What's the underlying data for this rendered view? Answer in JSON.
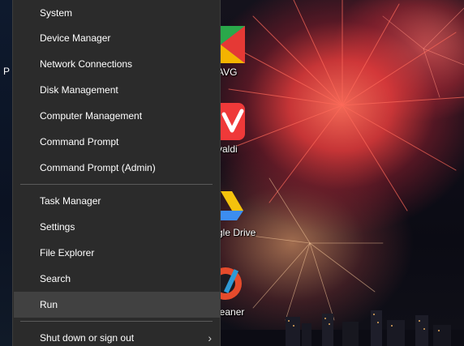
{
  "desktop": {
    "left_label": "P",
    "icons": [
      {
        "name": "avg-desktop-icon",
        "label": "AVG"
      },
      {
        "name": "vivaldi-desktop-icon",
        "label": "valdi"
      },
      {
        "name": "google-drive-desktop-icon",
        "label": "gle Drive"
      },
      {
        "name": "ccleaner-desktop-icon",
        "label": "leaner"
      }
    ]
  },
  "menu": {
    "items_group1": [
      {
        "label": "System"
      },
      {
        "label": "Device Manager"
      },
      {
        "label": "Network Connections"
      },
      {
        "label": "Disk Management"
      },
      {
        "label": "Computer Management"
      },
      {
        "label": "Command Prompt"
      },
      {
        "label": "Command Prompt (Admin)"
      }
    ],
    "items_group2": [
      {
        "label": "Task Manager"
      },
      {
        "label": "Settings"
      },
      {
        "label": "File Explorer"
      },
      {
        "label": "Search"
      },
      {
        "label": "Run"
      }
    ],
    "shutdown": {
      "label": "Shut down or sign out",
      "icon": "chevron-right-icon"
    }
  },
  "colors": {
    "menu_bg": "#2b2b2b",
    "menu_hover": "#414141",
    "text": "#ffffff"
  }
}
